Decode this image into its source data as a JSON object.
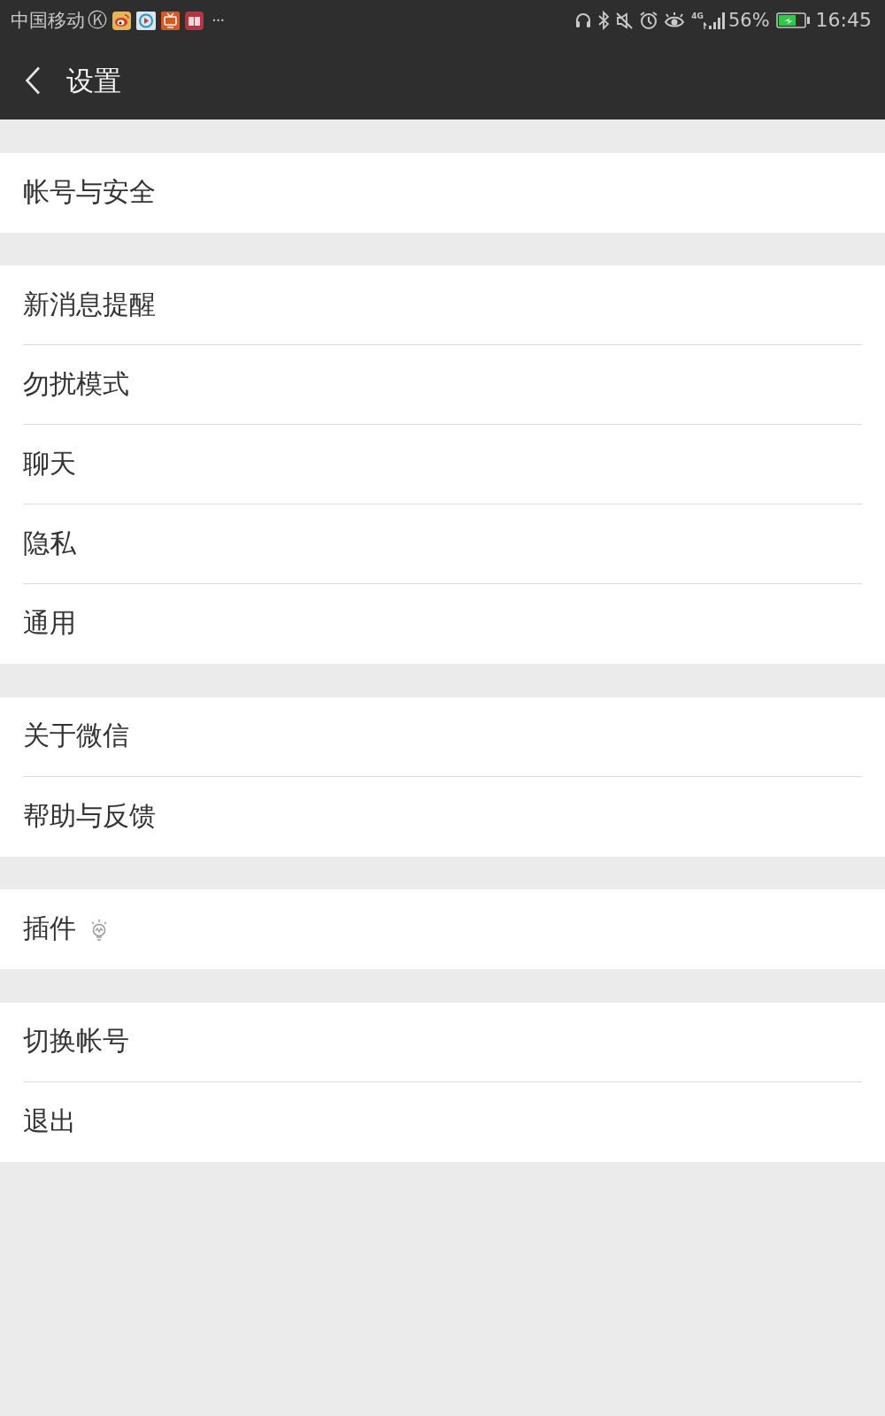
{
  "status_bar": {
    "carrier": "中国移动",
    "app_glyph": "Ⓚ",
    "more": "···",
    "network": "4G",
    "battery_percent": "56%",
    "time": "16:45"
  },
  "nav_bar": {
    "title": "设置"
  },
  "groups": [
    {
      "items": [
        {
          "label": "帐号与安全",
          "kind": "plain"
        }
      ]
    },
    {
      "items": [
        {
          "label": "新消息提醒",
          "kind": "plain"
        },
        {
          "label": "勿扰模式",
          "kind": "plain"
        },
        {
          "label": "聊天",
          "kind": "plain"
        },
        {
          "label": "隐私",
          "kind": "plain"
        },
        {
          "label": "通用",
          "kind": "plain"
        }
      ]
    },
    {
      "items": [
        {
          "label": "关于微信",
          "kind": "plain"
        },
        {
          "label": "帮助与反馈",
          "kind": "plain"
        }
      ]
    },
    {
      "items": [
        {
          "label": "插件",
          "kind": "icon"
        }
      ]
    },
    {
      "items": [
        {
          "label": "切换帐号",
          "kind": "plain"
        },
        {
          "label": "退出",
          "kind": "plain"
        }
      ]
    }
  ]
}
